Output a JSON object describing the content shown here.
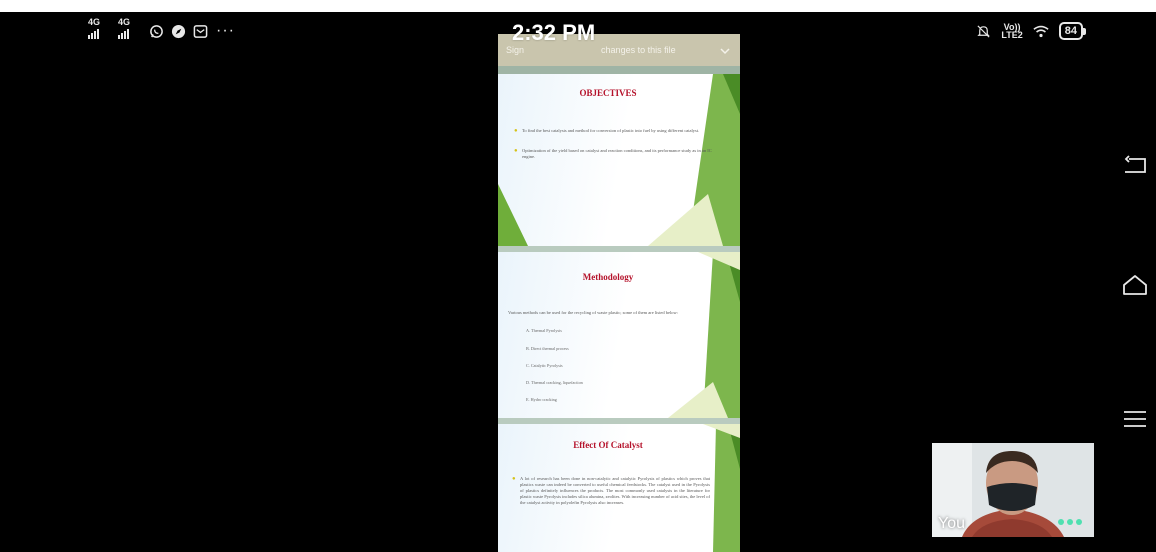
{
  "status_bar": {
    "sim1_label": "4G",
    "sim2_label": "4G",
    "more_label": "···",
    "volte_line1": "Vo))",
    "volte_line2": "LTE2",
    "battery_level": "84"
  },
  "viewer": {
    "banner_text_left": "Sign",
    "banner_text_right": "changes to this file",
    "time": "2:32 PM"
  },
  "slides": [
    {
      "title": "OBJECTIVES",
      "bullets": [
        "To find the best catalysts and method for conversion of plastic into fuel by using different catalyst.",
        "Optimization of the yield based on catalyst and reaction conditions, and its performance study as in an IC engine."
      ]
    },
    {
      "title": "Methodology",
      "intro": "Various methods can be used for the recycling of waste plastic; some of them are listed below:",
      "items": [
        "A. Thermal Pyrolysis",
        "B. Direct thermal process",
        "C. Catalytic Pyrolysis",
        "D. Thermal cracking, liquefaction",
        "E. Hydro cracking"
      ]
    },
    {
      "title": "Effect Of Catalyst",
      "bullets": [
        "A lot of research has been done in non-catalytic and catalytic Pyrolysis of plastics which proves that plastics waste can indeed be converted to useful chemical feedstocks. The catalyst used in the Pyrolysis of plastics definitely influences the products. The most commonly used catalysts in the literature for plastic waste Pyrolysis includes silica alumina, zeolites. With increasing number of acid sites, the level of the catalyst activity in polyolefin Pyrolysis also increases."
      ]
    }
  ],
  "self_video": {
    "label": "You"
  },
  "colors": {
    "slide_title": "#b5122b",
    "slide_green": "#6fae3a",
    "bullet_yellow": "#d5c21a",
    "dots_accent": "#4fe0b0"
  }
}
